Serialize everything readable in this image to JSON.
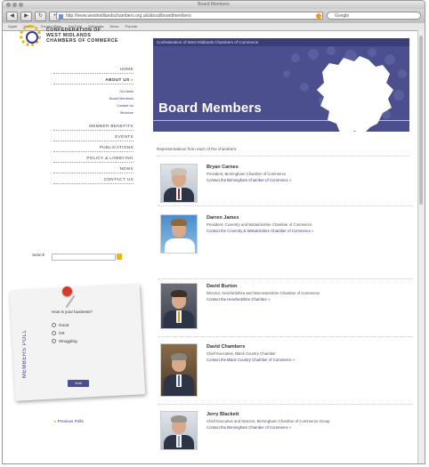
{
  "window": {
    "title": "Board Members",
    "url": "http://www.westmidlandschambers.org.uk/about/boardmembers",
    "search_placeholder": "Google",
    "bookmarks": [
      "Apple",
      "Yahoo!",
      "Google Maps",
      "YouTube",
      "Wikipedia",
      "News",
      "Popular"
    ]
  },
  "sidebar": {
    "logo_lines": [
      "CONFEDERATION OF",
      "WEST MIDLANDS",
      "CHAMBERS OF COMMERCE"
    ],
    "nav": [
      {
        "label": "HOME",
        "active": false
      },
      {
        "label": "ABOUT US",
        "active": true
      }
    ],
    "subnav": [
      "Our Aims",
      "Board Members",
      "Contact Us",
      "Structure"
    ],
    "nav2": [
      "MEMBER BENEFITS",
      "EVENTS",
      "PUBLICATIONS",
      "POLICY & LOBBYING",
      "NEWS",
      "CONTACT US"
    ],
    "search_label": "Search",
    "poll": {
      "side_title": "MEMBERS POLL",
      "question": "How is your business?",
      "options": [
        "Good",
        "OK",
        "Struggling"
      ],
      "vote_label": "Vote"
    },
    "previous_polls": "Previous Polls"
  },
  "banner": {
    "top_label": "Confederation of West Midlands Chambers of Commerce",
    "title": "Board Members"
  },
  "intro": "Representatives from each of the chambers:",
  "members": [
    {
      "name": "Bryan Carnes",
      "role": "President, Birmingham Chamber of Commerce",
      "link": "Contact the Birmingham Chamber of Commerce »"
    },
    {
      "name": "Darren James",
      "role": "President, Coventry and Warwickshire Chamber of Commerce",
      "link": "Contact the Coventry & Warwickshire Chamber of Commerce »"
    },
    {
      "name": "David Burton",
      "role": "Director, Herefordshire and Worcestershire Chamber of Commerce",
      "link": "Contact the Herefordshire Chamber »"
    },
    {
      "name": "David Chambers",
      "role": "Chief Executive, Black Country Chamber",
      "link": "Contact the Black Country Chamber of Commerce »"
    },
    {
      "name": "Jerry Blackett",
      "role": "Chief Executive and Director, Birmingham Chamber of Commerce Group",
      "link": "Contact the Birmingham Chamber of Commerce »"
    }
  ]
}
